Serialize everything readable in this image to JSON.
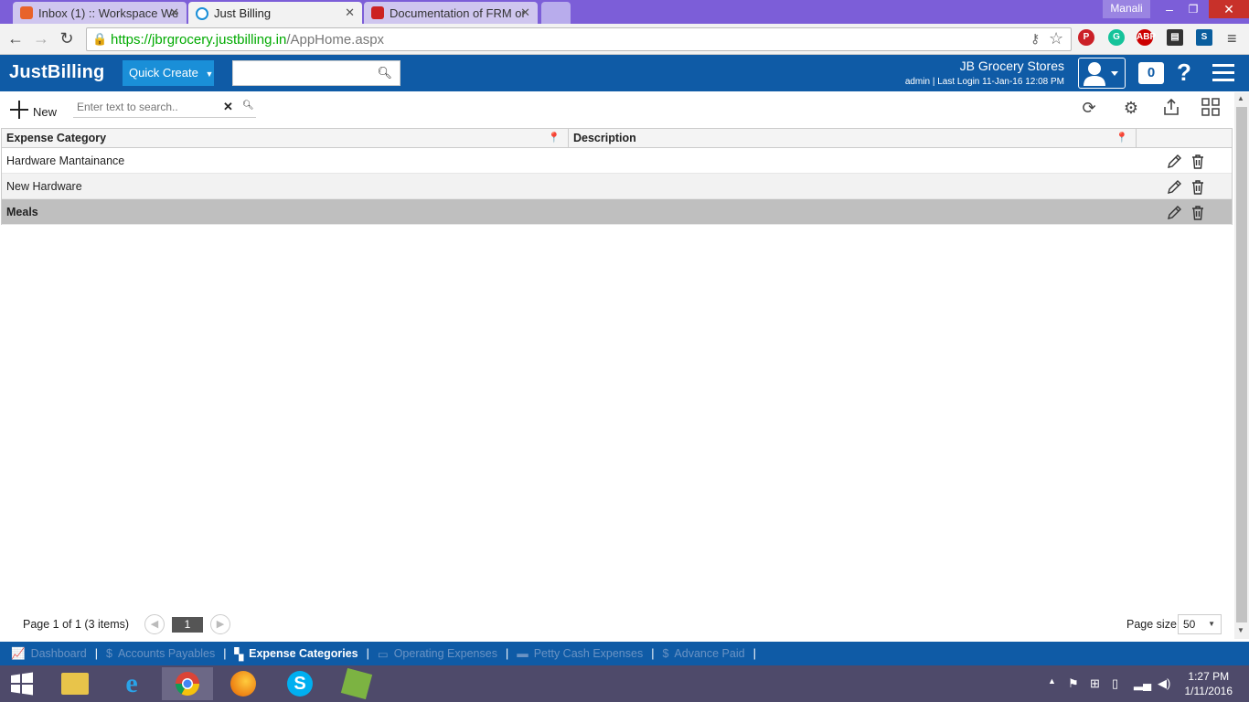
{
  "browser": {
    "tabs": [
      {
        "title": "Inbox (1) :: Workspace We",
        "active": false
      },
      {
        "title": "Just Billing",
        "active": true
      },
      {
        "title": "Documentation of FRM or",
        "active": false
      }
    ],
    "profile": "Manali",
    "url_secure": "https://jbrgrocery.justbilling.in",
    "url_path": "/AppHome.aspx"
  },
  "app": {
    "logo": "JustBilling",
    "quick_create": "Quick Create",
    "store_name": "JB Grocery Stores",
    "login_info": "admin | Last Login 11-Jan-16 12:08 PM",
    "notification_count": "0",
    "help": "?"
  },
  "toolbar": {
    "new_label": "New",
    "search_placeholder": "Enter text to search.."
  },
  "grid": {
    "columns": [
      "Expense Category",
      "Description"
    ],
    "rows": [
      {
        "category": "Hardware Mantainance",
        "description": ""
      },
      {
        "category": "New Hardware",
        "description": ""
      },
      {
        "category": "Meals",
        "description": ""
      }
    ]
  },
  "pager": {
    "summary": "Page 1 of 1 (3 items)",
    "current_page": "1",
    "page_size_label": "Page size:",
    "page_size": "50"
  },
  "bottom_tabs": [
    {
      "label": "Dashboard",
      "active": false
    },
    {
      "label": "Accounts Payables",
      "active": false
    },
    {
      "label": "Expense Categories",
      "active": true
    },
    {
      "label": "Operating Expenses",
      "active": false
    },
    {
      "label": "Petty Cash Expenses",
      "active": false
    },
    {
      "label": "Advance Paid",
      "active": false
    }
  ],
  "taskbar": {
    "time": "1:27 PM",
    "date": "1/11/2016"
  },
  "colors": {
    "brand": "#0f5ba6",
    "quick_create": "#1a8fd8",
    "selected_row": "#bfbfbf"
  }
}
